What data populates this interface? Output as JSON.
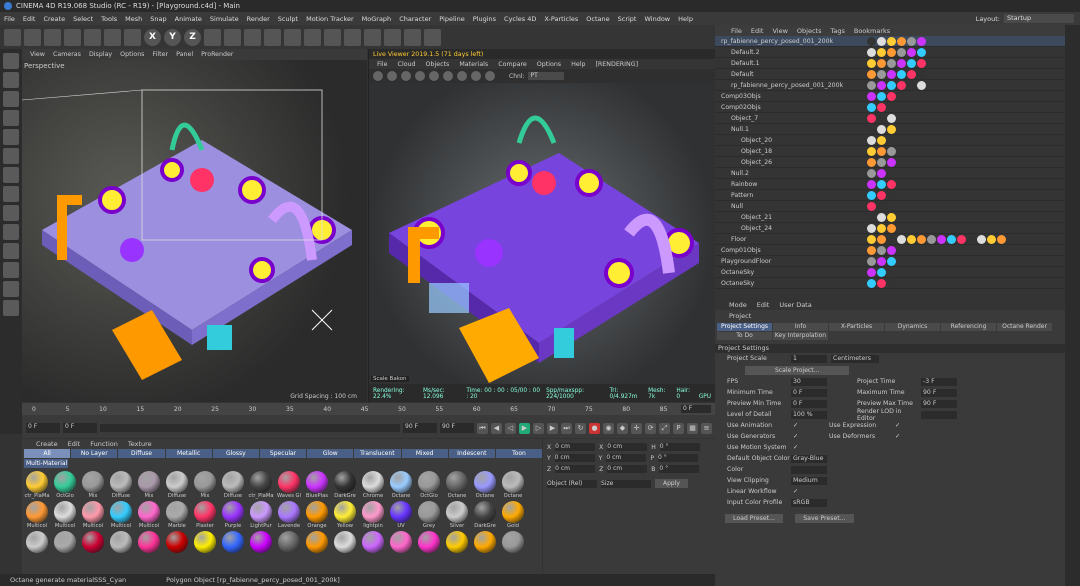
{
  "window": {
    "title": "CINEMA 4D R19.068 Studio (RC - R19) - [Playground.c4d] - Main"
  },
  "menu": [
    "File",
    "Edit",
    "Create",
    "Select",
    "Tools",
    "Mesh",
    "Snap",
    "Animate",
    "Simulate",
    "Render",
    "Sculpt",
    "Motion Tracker",
    "MoGraph",
    "Character",
    "Pipeline",
    "Plugins",
    "Cycles 4D",
    "X-Particles",
    "Octane",
    "Script",
    "Window",
    "Help"
  ],
  "layout": {
    "label": "Layout:",
    "value": "Startup"
  },
  "toolbar": [
    "X",
    "Y",
    "Z"
  ],
  "viewport": {
    "menu": [
      "View",
      "Cameras",
      "Display",
      "Options",
      "Filter",
      "Panel",
      "ProRender"
    ],
    "label": "Perspective",
    "grid": "Grid Spacing : 100 cm"
  },
  "liveviewer": {
    "title": "Live Viewer 2019.1.5 (71 days left)",
    "menu": [
      "File",
      "Cloud",
      "Objects",
      "Materials",
      "Compare",
      "Options",
      "Help",
      "[RENDERING]"
    ],
    "chnl_label": "Chnl:",
    "chnl_value": "PT",
    "status": [
      "Rendering: 22.4%",
      "Ms/sec: 12.096",
      "Time: 00 : 00 : 05/00 : 00 : 20",
      "Spp/maxspp: 224/1000",
      "Tri: 0/4.927m",
      "Mesh: 7k",
      "Hair: 0",
      "GPU"
    ],
    "tag": "Scale Bakon"
  },
  "timeline": {
    "ticks": [
      "0",
      "5",
      "10",
      "15",
      "20",
      "25",
      "30",
      "35",
      "40",
      "45",
      "50",
      "55",
      "60",
      "65",
      "70",
      "75",
      "80",
      "85",
      "90"
    ],
    "start": "0 F",
    "mid1": "0 F",
    "mid2": "90 F",
    "end": "90 F",
    "current": "0 F"
  },
  "materials": {
    "menu": [
      "Create",
      "Edit",
      "Function",
      "Texture"
    ],
    "tabs": [
      "All",
      "No Layer",
      "Diffuse",
      "Metallic",
      "Glossy",
      "Specular",
      "Glow",
      "Translucent",
      "Mixed",
      "Indescent",
      "Toon"
    ],
    "layer": "Multi-Material",
    "items": [
      {
        "n": "ctr_PlaMa",
        "c": "#ffcc33"
      },
      {
        "n": "OctGlo",
        "c": "#33cc99"
      },
      {
        "n": "Mix",
        "c": "#999"
      },
      {
        "n": "Diffuse",
        "c": "#bbb"
      },
      {
        "n": "Mix",
        "c": "#a9a"
      },
      {
        "n": "Diffuse",
        "c": "#ccc"
      },
      {
        "n": "Mix",
        "c": "#999"
      },
      {
        "n": "Diffuse",
        "c": "#bbb"
      },
      {
        "n": "ctr_PlaMa",
        "c": "#444"
      },
      {
        "n": "Waves Gl",
        "c": "#ff3366"
      },
      {
        "n": "BluePlas",
        "c": "#cc33ff"
      },
      {
        "n": "DarkGre",
        "c": "#333"
      },
      {
        "n": "Chrome",
        "c": "#ddd"
      },
      {
        "n": "Octane",
        "c": "#9cf"
      },
      {
        "n": "OctGlo",
        "c": "#999"
      },
      {
        "n": "Octane",
        "c": "#666"
      },
      {
        "n": "Octane",
        "c": "#99f"
      },
      {
        "n": "Octane",
        "c": "#bbb"
      },
      {
        "n": "Multicol",
        "c": "#ff9933"
      },
      {
        "n": "Multicol",
        "c": "#ddd"
      },
      {
        "n": "Multicol",
        "c": "#f9a"
      },
      {
        "n": "Multicol",
        "c": "#33ccff"
      },
      {
        "n": "Multicol",
        "c": "#ff66cc"
      },
      {
        "n": "Marble",
        "c": "#aaa"
      },
      {
        "n": "Plaster",
        "c": "#ff3366"
      },
      {
        "n": "Purple",
        "c": "#9933ff"
      },
      {
        "n": "LightPur",
        "c": "#cc99ff"
      },
      {
        "n": "Lavende",
        "c": "#aa77ff"
      },
      {
        "n": "Orange",
        "c": "#ff9900"
      },
      {
        "n": "Yellow",
        "c": "#ffee33"
      },
      {
        "n": "lightpin",
        "c": "#ff99cc"
      },
      {
        "n": "UV",
        "c": "#6633ff"
      },
      {
        "n": "Grey",
        "c": "#999"
      },
      {
        "n": "Silver",
        "c": "#ccc"
      },
      {
        "n": "DarkGre",
        "c": "#444"
      },
      {
        "n": "Gold",
        "c": "#ffaa00"
      },
      {
        "n": "",
        "c": "#ccc"
      },
      {
        "n": "",
        "c": "#aaa"
      },
      {
        "n": "",
        "c": "#cc0033"
      },
      {
        "n": "",
        "c": "#bbb"
      },
      {
        "n": "",
        "c": "#ff3399"
      },
      {
        "n": "",
        "c": "#cc0000"
      },
      {
        "n": "",
        "c": "#ffee00"
      },
      {
        "n": "",
        "c": "#3366ff"
      },
      {
        "n": "",
        "c": "#cc00ff"
      },
      {
        "n": "",
        "c": "#666"
      },
      {
        "n": "",
        "c": "#ff9900"
      },
      {
        "n": "",
        "c": "#ddd"
      },
      {
        "n": "",
        "c": "#cc66ff"
      },
      {
        "n": "",
        "c": "#ff66cc"
      },
      {
        "n": "",
        "c": "#ff33cc"
      },
      {
        "n": "",
        "c": "#ffcc00"
      },
      {
        "n": "",
        "c": "#ffaa00"
      },
      {
        "n": "",
        "c": "#999"
      }
    ]
  },
  "coords": {
    "rows": [
      [
        "X",
        "0 cm",
        "X",
        "0 cm",
        "H",
        "0 °"
      ],
      [
        "Y",
        "0 cm",
        "Y",
        "0 cm",
        "P",
        "0 °"
      ],
      [
        "Z",
        "0 cm",
        "Z",
        "0 cm",
        "B",
        "0 °"
      ]
    ],
    "mode1": "Object (Rel)",
    "mode2": "Size",
    "apply": "Apply"
  },
  "status": {
    "left": "Octane generate materialSSS_Cyan",
    "right": "Polygon Object [rp_fabienne_percy_posed_001_200k]"
  },
  "objects": {
    "menu": [
      "File",
      "Edit",
      "View",
      "Objects",
      "Tags",
      "Bookmarks"
    ],
    "rows": [
      {
        "n": "rp_fabienne_percy_posed_001_200k",
        "i": 0
      },
      {
        "n": "Default.2",
        "i": 1
      },
      {
        "n": "Default.1",
        "i": 1
      },
      {
        "n": "Default",
        "i": 1
      },
      {
        "n": "rp_fabienne_percy_posed_001_200k",
        "i": 1
      },
      {
        "n": "Comp03Objs",
        "i": 0
      },
      {
        "n": "Comp02Objs",
        "i": 0
      },
      {
        "n": "Object_7",
        "i": 1
      },
      {
        "n": "Null.1",
        "i": 1
      },
      {
        "n": "Object_20",
        "i": 2
      },
      {
        "n": "Object_18",
        "i": 2
      },
      {
        "n": "Object_26",
        "i": 2
      },
      {
        "n": "Null.2",
        "i": 1
      },
      {
        "n": "Rainbow",
        "i": 1
      },
      {
        "n": "Pattern",
        "i": 1
      },
      {
        "n": "Null",
        "i": 1
      },
      {
        "n": "Object_21",
        "i": 2
      },
      {
        "n": "Object_24",
        "i": 2
      },
      {
        "n": "Floor",
        "i": 1
      },
      {
        "n": "Comp01Objs",
        "i": 0
      },
      {
        "n": "PlaygroundFloor",
        "i": 0
      },
      {
        "n": "OctaneSky",
        "i": 0
      },
      {
        "n": "OctaneSky",
        "i": 0
      }
    ]
  },
  "attributes": {
    "menu": [
      "Mode",
      "Edit",
      "User Data"
    ],
    "header": "Project",
    "tabs": [
      "Project Settings",
      "Info",
      "X-Particles",
      "Dynamics",
      "Referencing",
      "Octane Render",
      "To Do",
      "Key Interpolation"
    ],
    "section": "Project Settings",
    "scale_label": "Project Scale",
    "scale_value": "1",
    "scale_unit": "Centimeters",
    "scale_button": "Scale Project...",
    "left": [
      [
        "FPS",
        "30"
      ],
      [
        "Minimum Time",
        "0 F"
      ],
      [
        "Preview Min Time",
        "0 F"
      ],
      [
        "Level of Detail",
        "100 %"
      ],
      [
        "Use Animation",
        "✓"
      ],
      [
        "Use Generators",
        "✓"
      ],
      [
        "Use Motion System",
        "✓"
      ],
      [
        "Default Object Color",
        "Gray-Blue"
      ],
      [
        "Color",
        ""
      ],
      [
        "View Clipping",
        "Medium"
      ],
      [
        "Linear Workflow",
        "✓"
      ],
      [
        "Input Color Profile",
        "sRGB"
      ]
    ],
    "right": [
      [
        "Project Time",
        "-3 F"
      ],
      [
        "Maximum Time",
        "90 F"
      ],
      [
        "Preview Max Time",
        "90 F"
      ],
      [
        "Render LOD in Editor",
        ""
      ],
      [
        "Use Expression",
        "✓"
      ],
      [
        "Use Deformers",
        "✓"
      ]
    ],
    "load": "Load Preset...",
    "save": "Save Preset..."
  }
}
